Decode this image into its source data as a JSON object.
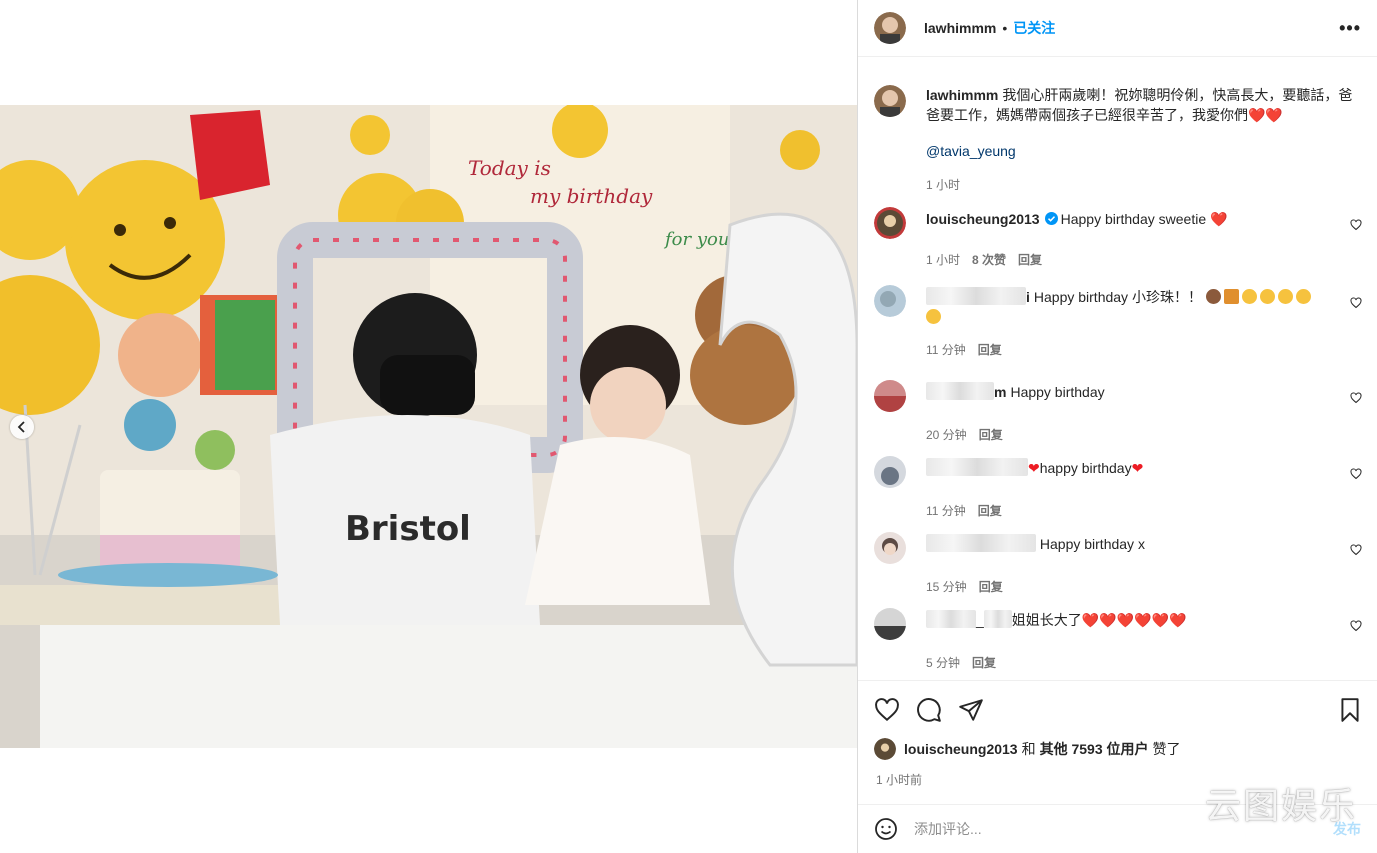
{
  "post": {
    "username": "lawhimmm",
    "follow_status": "已关注",
    "more_label": "•••",
    "caption": "我個心肝兩歲喇！祝妳聰明伶俐，快高長大，要聽話，爸爸要工作，媽媽帶兩個孩子已經很辛苦了，我愛你們",
    "caption_hearts": "❤️❤️",
    "mention": "@tavia_yeung",
    "caption_time": "1 小时"
  },
  "comments": [
    {
      "username": "louischeung2013",
      "verified": true,
      "text": "Happy birthday sweetie",
      "hearts": "❤️",
      "time": "1 小时",
      "likes": "8 次赞",
      "reply": "回复"
    },
    {
      "username_tail": "i",
      "text": "Happy birthday 小珍珠！！",
      "time": "11 分钟",
      "reply": "回复"
    },
    {
      "username_tail": "m",
      "text": "Happy birthday",
      "time": "20 分钟",
      "reply": "回复"
    },
    {
      "text": "happy birthday",
      "time": "11 分钟",
      "reply": "回复"
    },
    {
      "text": "Happy birthday x",
      "time": "15 分钟",
      "reply": "回复"
    },
    {
      "text_prefix": "_",
      "text": "姐姐长大了",
      "hearts": "❤️❤️❤️❤️❤️❤️",
      "time": "5 分钟",
      "reply": "回复"
    }
  ],
  "likes": {
    "user": "louischeung2013",
    "connector": "和",
    "others": "其他 7593 位用户",
    "suffix": "赞了"
  },
  "posted_time": "1 小时前",
  "add_comment": {
    "placeholder": "添加评论...",
    "post_label": "发布"
  },
  "watermark": "云图娱乐",
  "colors": {
    "accent": "#0095f6",
    "heart": "#ed1c24",
    "mention": "#00376b",
    "muted": "#737373"
  }
}
